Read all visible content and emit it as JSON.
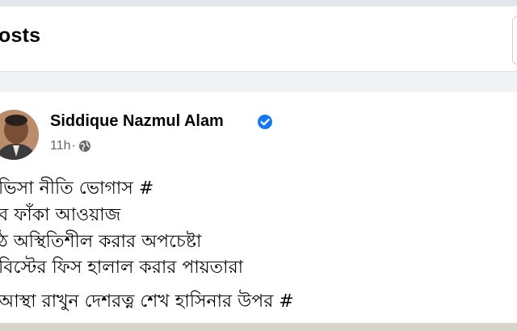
{
  "header": {
    "title": "osts"
  },
  "post": {
    "author": "Siddique Nazmul Alam",
    "time": "11h",
    "separator": "·",
    "lines": [
      "ভিসা নীতি ভোগাস #",
      "ব ফাঁকা আওয়াজ",
      "ঠ অস্থিতিশীল করার অপচেষ্টা",
      "বিস্টের ফিস হালাল করার পায়তারা",
      "আস্থা রাখুন দেশরত্ন শেখ হাসিনার উপর #"
    ]
  },
  "colors": {
    "background": "#f0f2f5",
    "card": "#ffffff",
    "text": "#050505",
    "secondary_text": "#65676b",
    "verified_badge": "#1877f2"
  },
  "icons": {
    "verified": "verified-badge-icon",
    "audience": "globe-icon"
  }
}
